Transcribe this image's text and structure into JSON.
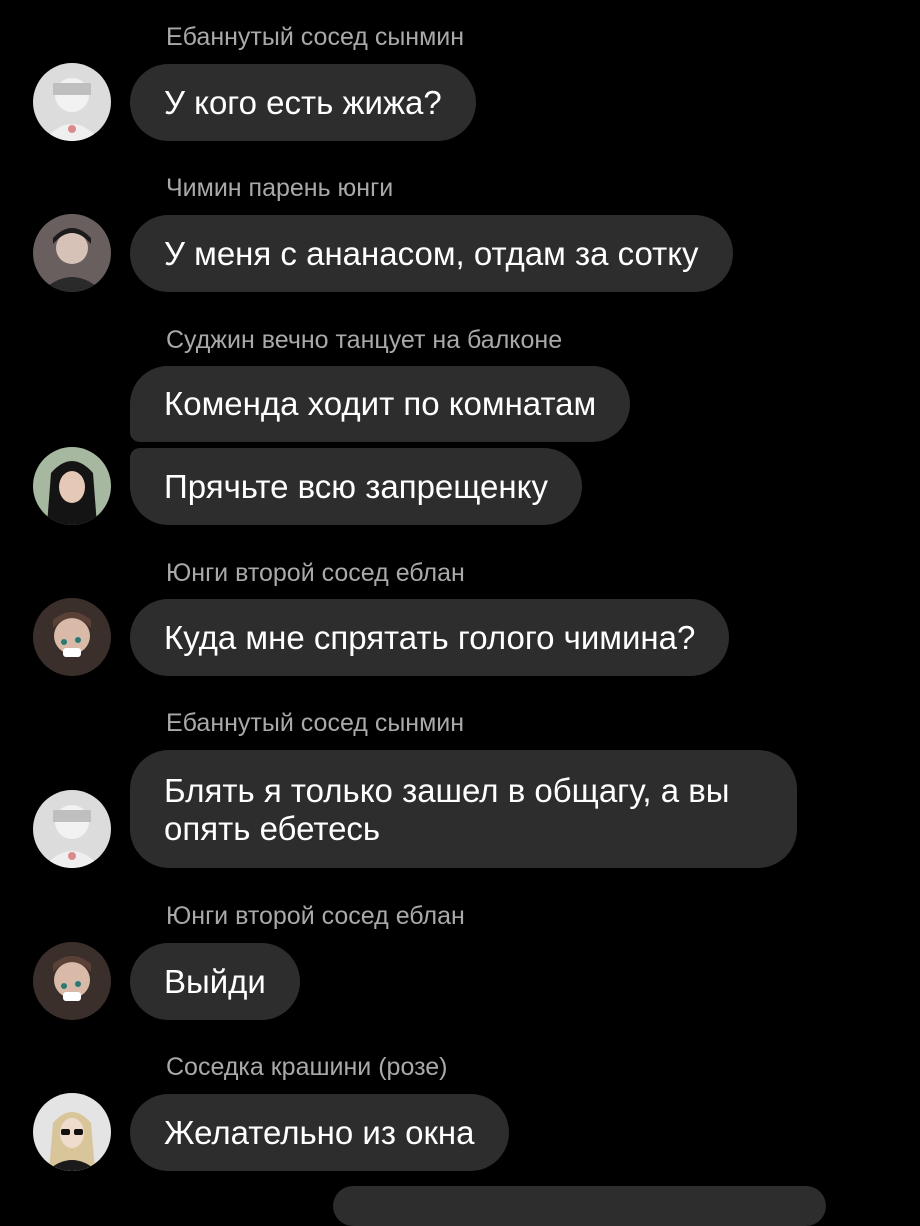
{
  "chat": {
    "messages": [
      {
        "sender": "Ебаннутый сосед сынмин",
        "text": "У кого есть жижа?"
      },
      {
        "sender": "Чимин парень юнги",
        "text": "У меня с ананасом, отдам за сотку"
      },
      {
        "sender": "Суджин вечно танцует на балконе",
        "text": "Коменда ходит по комнатам"
      },
      {
        "sender": "",
        "text": "Прячьте всю запрещенку"
      },
      {
        "sender": "Юнги второй сосед еблан",
        "text": "Куда мне спрятать голого чимина?"
      },
      {
        "sender": "Ебаннутый сосед сынмин",
        "text": "Блять я только зашел в общагу, а вы опять ебетесь"
      },
      {
        "sender": "Юнги второй сосед еблан",
        "text": "Выйди"
      },
      {
        "sender": "Соседка крашини (розе)",
        "text": "Желательно из окна"
      }
    ]
  },
  "colors": {
    "background": "#000000",
    "bubble": "#2d2d2d",
    "sender_text": "#a9a9a9",
    "message_text": "#ffffff"
  }
}
